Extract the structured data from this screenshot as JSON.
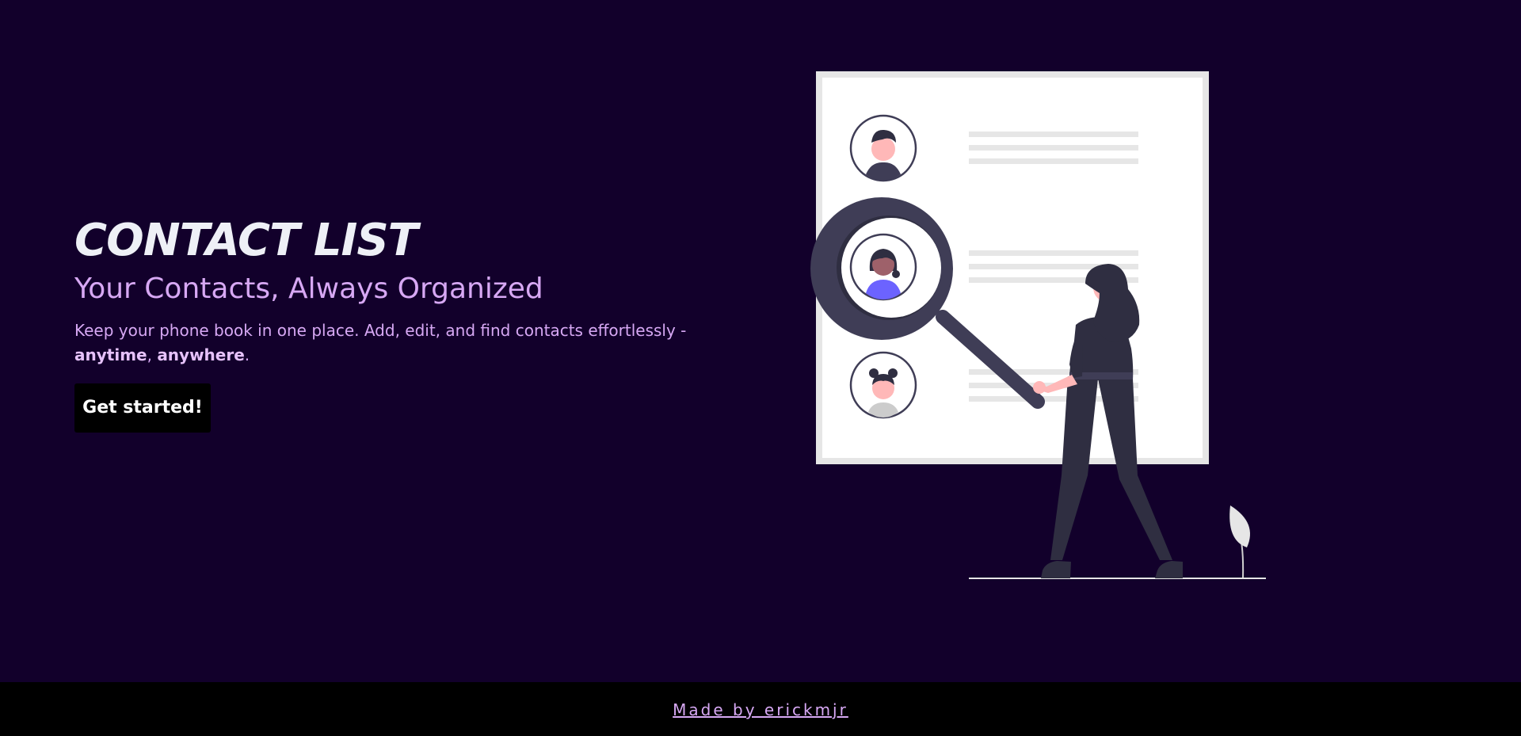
{
  "hero": {
    "title": "CONTACT LIST",
    "subtitle": "Your Contacts, Always Organized",
    "description_prefix": "Keep your phone book in one place. Add, edit, and find contacts effortlessly - ",
    "description_bold_1": "anytime",
    "description_separator": ", ",
    "description_bold_2": "anywhere",
    "description_suffix": ".",
    "cta_label": "Get started!"
  },
  "illustration": {
    "icon": "contact-search-illustration"
  },
  "footer": {
    "credit_label": "Made by erickmjr"
  },
  "colors": {
    "background": "#12002b",
    "title": "#eef0f6",
    "accent": "#d7a8f4",
    "button_bg": "#000000",
    "footer_bg": "#000000",
    "figure_dark": "#3f3d56",
    "highlight": "#6c63ff"
  }
}
